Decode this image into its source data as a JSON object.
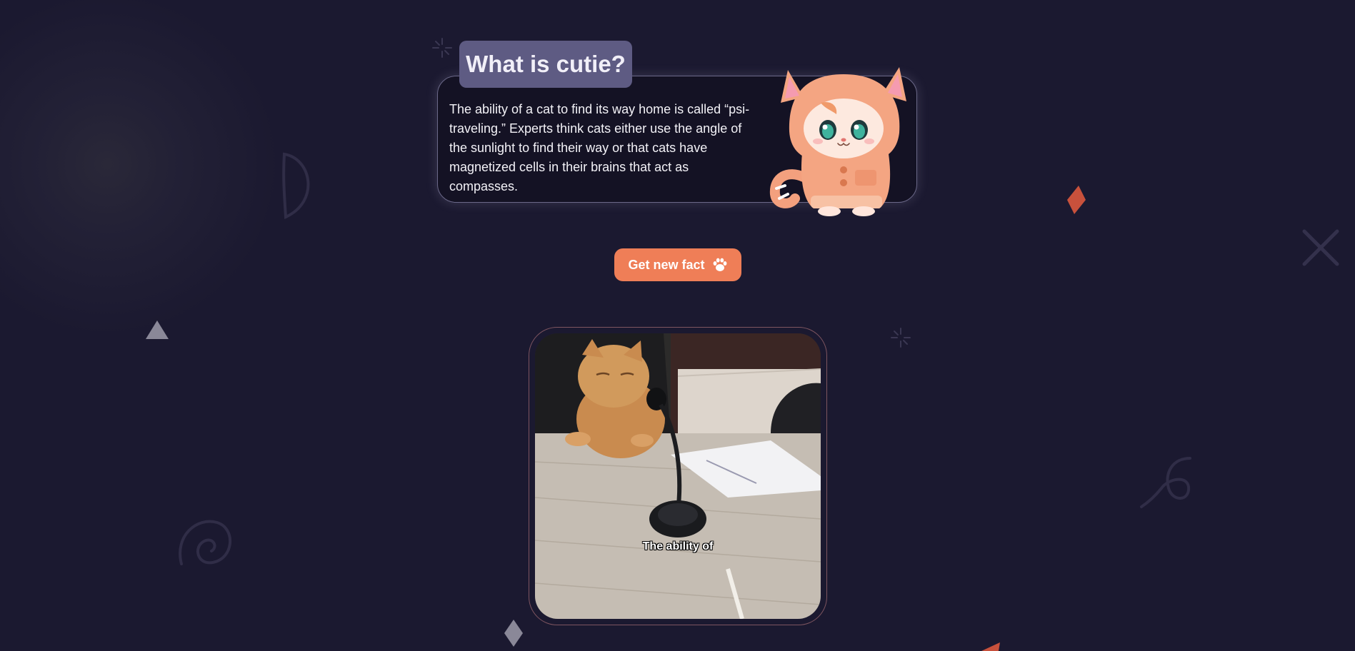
{
  "card": {
    "title": "What is cutie?",
    "fact": "The ability of a cat to find its way home is called “psi-traveling.” Experts think cats either use the angle of the sunlight to find their way or that cats have magnetized cells in their brains that act as compasses."
  },
  "button": {
    "label": "Get new fact",
    "icon": "paw-icon"
  },
  "meme": {
    "caption": "The ability of"
  },
  "colors": {
    "background": "#1b1930",
    "card_background": "#141224",
    "title_badge": "#5e5b83",
    "accent": "#ef7e57",
    "decoration_accent": "#c8513c"
  }
}
